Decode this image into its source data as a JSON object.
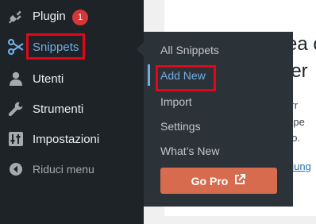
{
  "sidebar": {
    "items": [
      {
        "label": "Plugin",
        "icon": "plug-icon",
        "badge": "1"
      },
      {
        "label": "Snippets",
        "icon": "scissors-icon"
      },
      {
        "label": "Utenti",
        "icon": "user-icon"
      },
      {
        "label": "Strumenti",
        "icon": "wrench-icon"
      },
      {
        "label": "Impostazioni",
        "icon": "sliders-icon"
      },
      {
        "label": "Riduci menu",
        "icon": "collapse-arrow-icon"
      }
    ]
  },
  "flyout": {
    "items": [
      {
        "label": "All Snippets"
      },
      {
        "label": "Add New"
      },
      {
        "label": "Import"
      },
      {
        "label": "Settings"
      },
      {
        "label": "What’s New"
      }
    ],
    "gopro_label": "Go Pro"
  },
  "background": {
    "line1": "ea c",
    "line2": "tter",
    "line3": "tterr",
    "line4": "li pe",
    "line5": "po.",
    "link": "giung"
  },
  "colors": {
    "sidebar_bg": "#1d2327",
    "flyout_bg": "#2c3338",
    "accent": "#72aee6",
    "badge": "#d63638",
    "gopro": "#d76b4e",
    "highlight": "#e3061a"
  }
}
